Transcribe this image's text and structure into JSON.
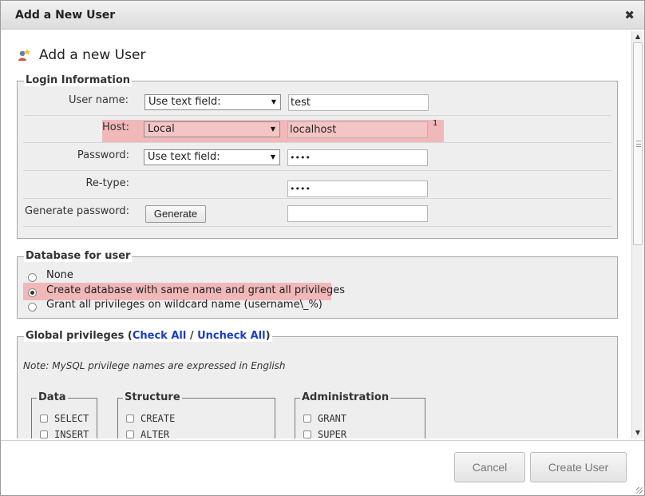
{
  "dialog": {
    "title": "Add a New User",
    "close_symbol": "✖",
    "close_icon": "close-icon"
  },
  "heading": {
    "text": "Add a new User",
    "icon": "user-add-icon"
  },
  "login": {
    "legend": "Login Information",
    "username_label": "User name:",
    "username_mode": "Use text field:",
    "username_value": "test",
    "host_label": "Host:",
    "host_mode": "Local",
    "host_value": "localhost",
    "host_footnote": "1",
    "password_label": "Password:",
    "password_mode": "Use text field:",
    "password_value": "••••",
    "retype_label": "Re-type:",
    "retype_value": "••••",
    "generate_label": "Generate password:",
    "generate_button": "Generate",
    "generated_value": "",
    "dropdown_arrow": "▼"
  },
  "database": {
    "legend": "Database for user",
    "options": [
      {
        "label": "None",
        "checked": false
      },
      {
        "label": "Create database with same name and grant all privileges",
        "checked": true
      },
      {
        "label": "Grant all privileges on wildcard name (username\\_%)",
        "checked": false
      }
    ]
  },
  "global_privileges": {
    "legend_prefix": "Global privileges (",
    "check_all": "Check All",
    "separator": " / ",
    "uncheck_all": "Uncheck All",
    "legend_suffix": ")",
    "note": "Note: MySQL privilege names are expressed in English",
    "groups": [
      {
        "legend": "Data",
        "items": [
          "SELECT",
          "INSERT"
        ]
      },
      {
        "legend": "Structure",
        "items": [
          "CREATE",
          "ALTER"
        ]
      },
      {
        "legend": "Administration",
        "items": [
          "GRANT",
          "SUPER"
        ]
      }
    ]
  },
  "footer": {
    "cancel": "Cancel",
    "create_user": "Create User"
  },
  "colors": {
    "highlight": "#f0b8b8",
    "link": "#1a3cc8",
    "fieldset_bg": "#eeeeee"
  }
}
